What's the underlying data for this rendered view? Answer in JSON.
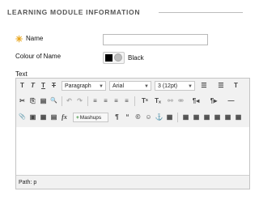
{
  "section": {
    "title": "LEARNING MODULE INFORMATION"
  },
  "form": {
    "required_marker": "✳",
    "name_label": "Name",
    "name_value": "",
    "colour_label": "Colour of Name",
    "colour_value_text": "Black",
    "colour_swatch": "#000000",
    "text_label": "Text"
  },
  "toolbar": {
    "row1": {
      "bold": "T",
      "italic": "T",
      "underline": "T",
      "strike": "T",
      "format": "Paragraph",
      "font": "Arial",
      "size": "3 (12pt)",
      "bullets": "☰",
      "numbers": "☰",
      "text_color": "T"
    },
    "row2": {
      "cut": "✂",
      "copy": "⎘",
      "paste": "▤",
      "search": "🔍",
      "undo": "↶",
      "redo": "↷",
      "align_left": "≡",
      "align_center": "≡",
      "align_right": "≡",
      "justify": "≡",
      "superscript": "Tˢ",
      "subscript": "Tₓ",
      "link": "⚯",
      "unlink": "⚮",
      "ltr": "¶◂",
      "rtl": "¶▸",
      "hr": "—"
    },
    "row3": {
      "attach": "📎",
      "image": "▣",
      "media": "▦",
      "doc": "▤",
      "formula": "fx",
      "mashups": "Mashups",
      "pilcrow": "¶",
      "quote": "“",
      "special": "©",
      "emoticon": "☺",
      "anchor": "⚓",
      "table": "▦"
    }
  },
  "editor": {
    "path_label": "Path:",
    "path_value": "p"
  }
}
